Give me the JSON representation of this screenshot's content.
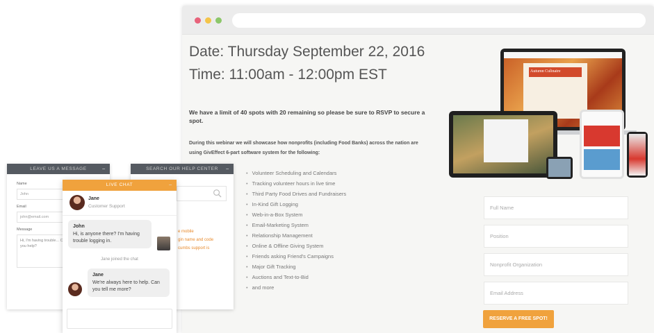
{
  "event": {
    "date": "Date: Thursday September 22, 2016",
    "time": "Time: 11:00am - 12:00pm EST",
    "limit_text": "We have a limit of 40 spots with 20 remaining so please be sure to RSVP to secure a spot.",
    "intro_text": "During this webinar we will showcase how nonprofits (including Food Banks) across the nation are using GivEffect 6-part software system for the following:",
    "features": [
      "Volunteer Scheduling and Calendars",
      "Tracking volunteer hours in live time",
      "Third Party Food Drives and Fundraisers",
      "In-Kind Gift Logging",
      "Web-in-a-Box System",
      "Email-Marketing System",
      "Relationship Management",
      "Online & Offline Giving System",
      "Friends asking Friend's Campaigns",
      "Major Gift Tracking",
      "Auctions and Text-to-Bid",
      "and more"
    ]
  },
  "form": {
    "full_name_placeholder": "Full Name",
    "position_placeholder": "Position",
    "org_placeholder": "Nonprofit Organization",
    "email_placeholder": "Email Address",
    "submit_label": "RESERVE A FREE SPOT!"
  },
  "devices": {
    "laptop_title": "Autumn Culinaire"
  },
  "leave_message": {
    "header": "LEAVE US A MESSAGE",
    "minimize": "−",
    "name_label": "Name",
    "name_value": "John",
    "email_label": "Email",
    "email_value": "john@email.com",
    "message_label": "Message",
    "message_value": "Hi, I'm having trouble... Can you help?"
  },
  "help_center": {
    "header": "SEARCH OUR HELP CENTER",
    "minimize": "−",
    "links": [
      "e mobile",
      "gin name and code",
      "cumbs support is"
    ]
  },
  "live_chat": {
    "header": "LIVE CHAT",
    "minimize": "−",
    "agent_name": "Jane",
    "agent_role": "Customer Support",
    "msg1_sender": "John",
    "msg1_text": "Hi, is anyone there? I'm having trouble logging in.",
    "joined_text": "Jane joined the chat",
    "msg2_sender": "Jane",
    "msg2_text": "We're always here to help. Can you tell me more?"
  },
  "colors": {
    "accent_orange": "#f0a23d",
    "widget_dark": "#555a61"
  }
}
